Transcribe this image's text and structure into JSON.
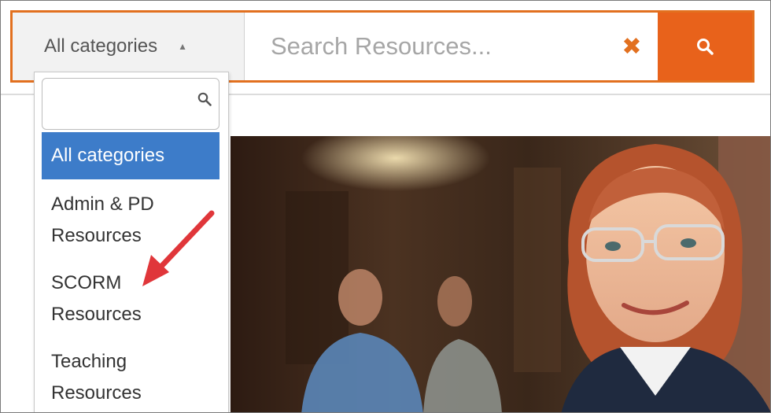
{
  "search": {
    "category_selected": "All categories",
    "placeholder": "Search Resources...",
    "caret": "▲",
    "clear_symbol": "✖"
  },
  "dropdown": {
    "items": [
      {
        "label": "All categories",
        "active": true
      },
      {
        "label": "Admin & PD\nResources"
      },
      {
        "label": "SCORM\nResources"
      },
      {
        "label": "Teaching\nResources"
      }
    ]
  },
  "icons": {
    "search": "magnifier-icon",
    "clear": "close-icon",
    "annotation": "red-arrow-annotation"
  },
  "colors": {
    "accent_orange": "#e8621b",
    "border_orange": "#e2701f",
    "selected_blue": "#3d7cc9",
    "annotation_red": "#e0363a"
  }
}
